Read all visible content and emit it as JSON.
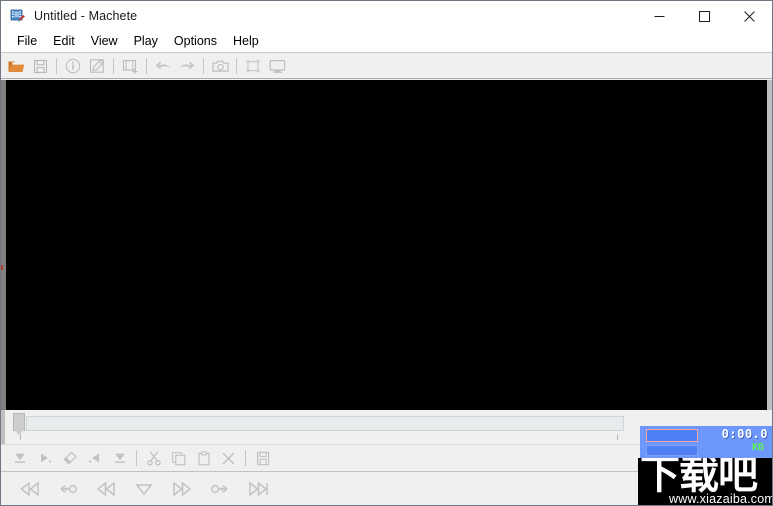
{
  "window": {
    "title": "Untitled - Machete",
    "icon": "film-strip-machete-icon",
    "controls": {
      "minimize": "—",
      "maximize": "□",
      "close": "✕"
    }
  },
  "menu": {
    "items": [
      {
        "label": "File",
        "name": "menu-file"
      },
      {
        "label": "Edit",
        "name": "menu-edit"
      },
      {
        "label": "View",
        "name": "menu-view"
      },
      {
        "label": "Play",
        "name": "menu-play"
      },
      {
        "label": "Options",
        "name": "menu-options"
      },
      {
        "label": "Help",
        "name": "menu-help"
      }
    ]
  },
  "toolbar": {
    "buttons": [
      {
        "name": "open-file-icon",
        "label": "Open",
        "enabled": true
      },
      {
        "name": "save-file-icon",
        "label": "Save",
        "enabled": false
      },
      {
        "name": "separator-1",
        "label": "",
        "enabled": false
      },
      {
        "name": "file-info-icon",
        "label": "File Information",
        "enabled": false
      },
      {
        "name": "edit-metadata-icon",
        "label": "Edit Metadata",
        "enabled": false
      },
      {
        "name": "separator-2",
        "label": "",
        "enabled": false
      },
      {
        "name": "insert-file-icon",
        "label": "Insert File",
        "enabled": false
      },
      {
        "name": "separator-3",
        "label": "",
        "enabled": false
      },
      {
        "name": "undo-icon",
        "label": "Undo",
        "enabled": false
      },
      {
        "name": "redo-icon",
        "label": "Redo",
        "enabled": false
      },
      {
        "name": "separator-4",
        "label": "",
        "enabled": false
      },
      {
        "name": "snapshot-camera-icon",
        "label": "Save Frame",
        "enabled": false
      },
      {
        "name": "separator-5",
        "label": "",
        "enabled": false
      },
      {
        "name": "crop-frame-icon",
        "label": "Crop",
        "enabled": false
      },
      {
        "name": "fullscreen-monitor-icon",
        "label": "Full Screen",
        "enabled": false
      }
    ]
  },
  "video": {
    "name": "video-preview-area",
    "background_color": "#000000"
  },
  "timeline": {
    "name": "timeline-slider",
    "playhead_position_percent": 0,
    "value": "0",
    "tick_label": ""
  },
  "edit_toolbar": {
    "buttons": [
      {
        "name": "set-selection-start-icon",
        "label": "Set Selection Start"
      },
      {
        "name": "play-selection-icon",
        "label": "Play Selection"
      },
      {
        "name": "clear-selection-icon",
        "label": "Clear Selection"
      },
      {
        "name": "goto-selection-end-icon",
        "label": "Go To Selection End"
      },
      {
        "name": "set-selection-end-icon",
        "label": "Set Selection End"
      },
      {
        "name": "separator-6",
        "label": ""
      },
      {
        "name": "cut-scissors-icon",
        "label": "Cut"
      },
      {
        "name": "copy-icon",
        "label": "Copy"
      },
      {
        "name": "paste-icon",
        "label": "Paste"
      },
      {
        "name": "delete-x-icon",
        "label": "Delete"
      },
      {
        "name": "separator-7",
        "label": ""
      },
      {
        "name": "save-selection-icon",
        "label": "Save Selection As"
      }
    ]
  },
  "transport": {
    "buttons": [
      {
        "name": "skip-to-start-icon",
        "label": "Go To Beginning"
      },
      {
        "name": "previous-keyframe-icon",
        "label": "Previous Key Frame"
      },
      {
        "name": "rewind-icon",
        "label": "Previous Frame"
      },
      {
        "name": "play-marker-icon",
        "label": "Play"
      },
      {
        "name": "fast-forward-icon",
        "label": "Next Frame"
      },
      {
        "name": "next-keyframe-icon",
        "label": "Next Key Frame"
      },
      {
        "name": "skip-to-end-icon",
        "label": "Go To End"
      }
    ]
  },
  "info_panel": {
    "name": "playback-info-panel",
    "time": "0:00.0",
    "unit": "KB",
    "accent_color": "#6e97fb",
    "time_color": "#ffffff",
    "unit_color": "#5cf25c"
  },
  "watermark": {
    "name": "site-watermark",
    "text_cn": "下载吧",
    "url": "www.xiazaiba.com"
  }
}
